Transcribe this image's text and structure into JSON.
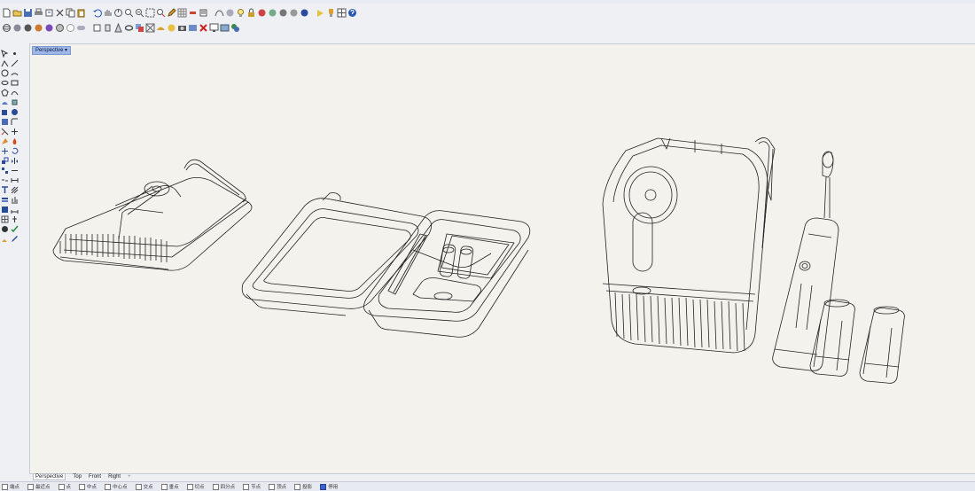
{
  "menu": {
    "items": [
      "",
      "",
      "",
      "",
      "",
      "",
      "",
      "",
      "",
      "",
      "",
      "",
      "",
      "",
      ""
    ]
  },
  "viewport": {
    "label": "Perspective",
    "dropdown_glyph": "▾"
  },
  "view_tabs": [
    "Perspective",
    "Top",
    "Front",
    "Right"
  ],
  "add_tab": "+",
  "snaps": [
    {
      "label": "端点",
      "on": false
    },
    {
      "label": "最近点",
      "on": false
    },
    {
      "label": "点",
      "on": false
    },
    {
      "label": "中点",
      "on": false
    },
    {
      "label": "中心点",
      "on": false
    },
    {
      "label": "交点",
      "on": false
    },
    {
      "label": "垂点",
      "on": false
    },
    {
      "label": "切点",
      "on": false
    },
    {
      "label": "四分点",
      "on": false
    },
    {
      "label": "节点",
      "on": false
    },
    {
      "label": "顶点",
      "on": false
    },
    {
      "label": "投影",
      "on": false
    },
    {
      "label": "停用",
      "on": true
    }
  ],
  "colors": {
    "accent": "#3b63c8",
    "viewport_bg": "#f3f2ec",
    "label_bg": "#9db7e6"
  }
}
